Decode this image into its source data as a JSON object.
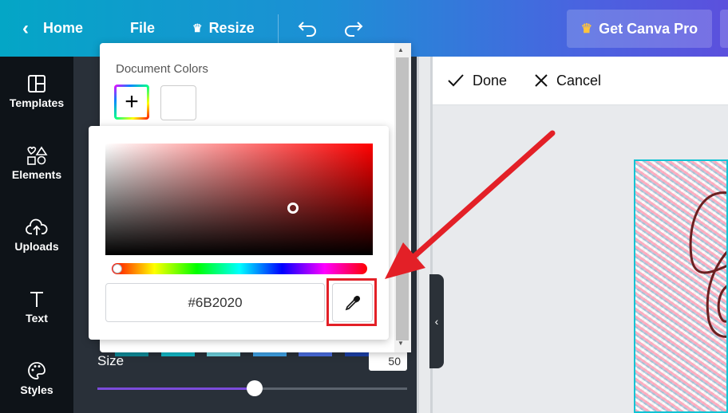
{
  "topbar": {
    "home_label": "Home",
    "file_label": "File",
    "resize_label": "Resize",
    "pro_label": "Get Canva Pro",
    "crown_icon": "crown-icon",
    "undo_icon": "undo-icon",
    "redo_icon": "redo-icon"
  },
  "rail": {
    "items": [
      {
        "label": "Templates",
        "icon": "templates-icon"
      },
      {
        "label": "Elements",
        "icon": "elements-icon"
      },
      {
        "label": "Uploads",
        "icon": "uploads-icon"
      },
      {
        "label": "Text",
        "icon": "text-icon"
      },
      {
        "label": "Styles",
        "icon": "palette-icon"
      }
    ]
  },
  "panel": {
    "size_label": "Size",
    "size_value": "50",
    "size_slider_fraction": 0.5,
    "swatch_colors": [
      "#0f8c9a",
      "#13b9c8",
      "#6fd3df",
      "#3fa3e8",
      "#4a6de0",
      "#1c3fa8"
    ]
  },
  "popup": {
    "doc_colors_label": "Document Colors",
    "hex_value": "#6B2020",
    "selected_color": "#6B2020",
    "hue_fraction": 0.0,
    "saturation": 0.7,
    "value": 0.42
  },
  "canvas": {
    "done_label": "Done",
    "cancel_label": "Cancel"
  },
  "colors": {
    "annotation_red": "#e32027",
    "accent_purple": "#7b4bdb"
  }
}
